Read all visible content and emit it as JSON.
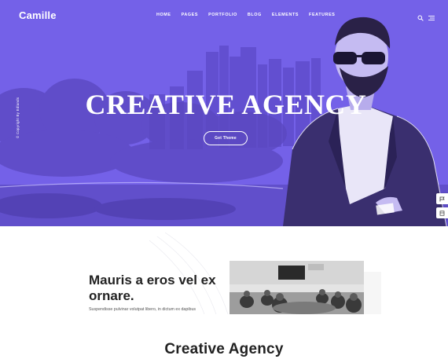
{
  "brand": {
    "logo": "Camille"
  },
  "nav": {
    "items": [
      "Home",
      "Pages",
      "Portfolio",
      "Blog",
      "Elements",
      "Features"
    ]
  },
  "header_icons": [
    "search-icon",
    "menu-icon"
  ],
  "hero": {
    "side_text": "© Copyright By Edlands",
    "headline": "CREATIVE AGENCY",
    "cta_label": "Get Theme",
    "accent_color": "#7461e8"
  },
  "side_buttons": [
    "flag-icon",
    "document-icon"
  ],
  "feature": {
    "title": "Mauris a eros vel ex ornare.",
    "text": "Suspendisse pulvinar volutpat libero, in dictum ex dapibus"
  },
  "section": {
    "title": "Creative Agency"
  }
}
